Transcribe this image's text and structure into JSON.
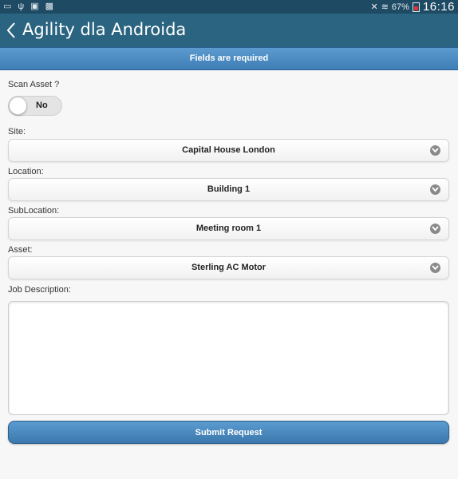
{
  "status_bar": {
    "time": "16:16",
    "battery_percent": "67%",
    "battery_level": 0.67,
    "left_icons": [
      "cast-icon",
      "usb-icon",
      "screenshot-icon",
      "image-icon"
    ],
    "right_icons": [
      "mute-icon",
      "wifi-icon",
      "battery-icon"
    ]
  },
  "action_bar": {
    "title": "Agility dla Androida",
    "back_icon": "chevron-left-icon"
  },
  "banner": {
    "text": "Fields are required"
  },
  "form": {
    "scan_asset": {
      "label": "Scan Asset ?",
      "value": "No",
      "on": false
    },
    "site": {
      "label": "Site:",
      "value": "Capital House London"
    },
    "location": {
      "label": "Location:",
      "value": "Building 1"
    },
    "sublocation": {
      "label": "SubLocation:",
      "value": "Meeting room 1"
    },
    "asset": {
      "label": "Asset:",
      "value": "Sterling AC Motor"
    },
    "job_description": {
      "label": "Job Description:",
      "value": ""
    },
    "submit_label": "Submit Request"
  },
  "colors": {
    "status_bar": "#1e4a63",
    "action_bar": "#2b6480",
    "accent_blue": "#4a8bc2",
    "background": "#f7f7f7"
  }
}
